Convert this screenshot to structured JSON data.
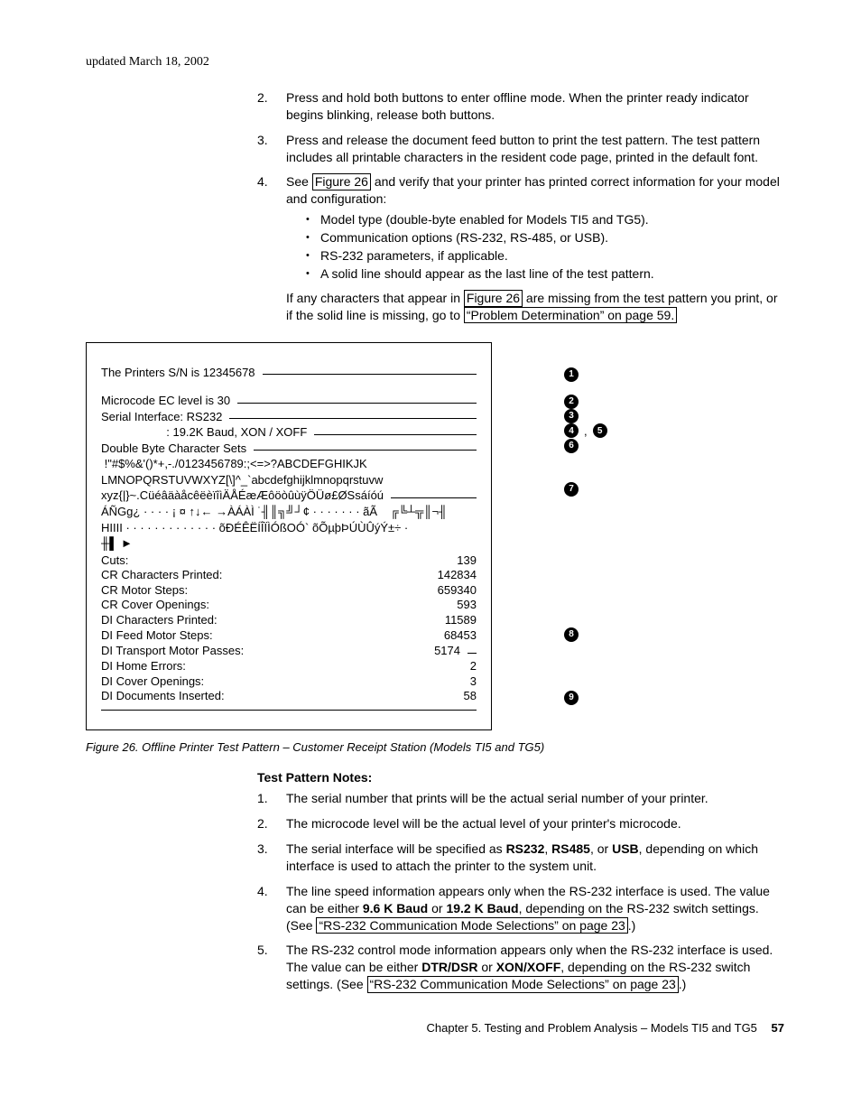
{
  "header": {
    "updated": "updated March 18, 2002"
  },
  "steps": {
    "s2": {
      "num": "2.",
      "text": "Press and hold both buttons to enter offline mode. When the printer ready indicator begins blinking, release both buttons."
    },
    "s3": {
      "num": "3.",
      "text": "Press and release the document feed button to print the test pattern. The test pattern includes all printable characters in the resident code page, printed in the default font."
    },
    "s4": {
      "num": "4.",
      "lead": "See ",
      "xref": "Figure 26",
      "tail": " and verify that your printer has printed correct information for your model and configuration:",
      "b1": "Model type (double-byte enabled for Models TI5 and TG5).",
      "b2": "Communication options (RS-232, RS-485, or USB).",
      "b3": "RS-232 parameters, if applicable.",
      "b4": "A solid line should appear as the last line of the test pattern.",
      "follow_a": "If any characters that appear in ",
      "follow_xref1": "Figure 26",
      "follow_b": " are missing from the test pattern you print, or if the solid line is missing, go to ",
      "follow_xref2": "“Problem Determination” on page 59."
    }
  },
  "figure": {
    "l1": "The Printers S/N is 12345678",
    "l2": "Microcode EC level is 30",
    "l3": "Serial Interface: RS232",
    "l4": "                    : 19.2K Baud, XON / XOFF",
    "l5": "Double Byte Character Sets",
    "l6": " !\"#$%&'()*+,-./0123456789:;<=>?ABCDEFGHIKJK",
    "l7": "LMNOPQRSTUVWXYZ[\\]^_`abcdefghijklmnopqrstuvw",
    "l8": "xyz{|}~.CüéâäàåcêëèïîìÄÅÉæÆôöòûùÿÖÜø£ØSsáíóú",
    "l9": "ÁÑGg¿ · · · · ¡ ¤ ↑↓← →ÀÁÀÌ ˙╢║╗╝┘¢ · · · · · · · ãÃ    ╔╚┴╦║¬╢",
    "l10": "HIIII · · · · · · · · · · · · · õĐÉÊËÍÎÏÌÓßOÓ` õÕµþÞÚÙÛýÝ±÷ ·",
    "l11": "╫▌ ►",
    "stats": {
      "r1l": "Cuts:",
      "r1v": "139",
      "r2l": "CR Characters Printed:",
      "r2v": "142834",
      "r3l": "CR Motor Steps:",
      "r3v": "659340",
      "r4l": "CR Cover Openings:",
      "r4v": "593",
      "r5l": "DI Characters Printed:",
      "r5v": "11589",
      "r6l": "DI Feed Motor Steps:",
      "r6v": "68453",
      "r7l": "DI Transport Motor Passes:",
      "r7v": "5174",
      "r8l": "DI Home Errors:",
      "r8v": "2",
      "r9l": "DI Cover Openings:",
      "r9v": "3",
      "r10l": "DI Documents Inserted:",
      "r10v": "58"
    },
    "caption": "Figure 26. Offline Printer Test Pattern – Customer Receipt Station (Models TI5 and TG5)",
    "callouts": {
      "c1": "1",
      "c2": "2",
      "c3": "3",
      "c45": "4",
      "c45b": "5",
      "c45sep": ",",
      "c6": "6",
      "c7": "7",
      "c8": "8",
      "c9": "9"
    }
  },
  "notes": {
    "heading": "Test Pattern Notes:",
    "n1": {
      "num": "1.",
      "text": "The serial number that prints will be the actual serial number of your printer."
    },
    "n2": {
      "num": "2.",
      "text": "The microcode level will be the actual level of your printer's microcode."
    },
    "n3": {
      "num": "3.",
      "a": "The serial interface will be specified as ",
      "b1": "RS232",
      "c": ", ",
      "b2": "RS485",
      "d": ", or ",
      "b3": "USB",
      "e": ", depending on which interface is used to attach the printer to the system unit."
    },
    "n4": {
      "num": "4.",
      "a": "The line speed information appears only when the RS-232 interface is used. The value can be either ",
      "b1": "9.6 K Baud",
      "c": " or ",
      "b2": "19.2 K Baud",
      "d": ", depending on the RS-232 switch settings. (See ",
      "xref": "“RS-232 Communication Mode Selections” on page 23",
      "e": ".)"
    },
    "n5": {
      "num": "5.",
      "a": "The RS-232 control mode information appears only when the RS-232 interface is used. The value can be either ",
      "b1": "DTR/DSR",
      "c": " or ",
      "b2": "XON/XOFF",
      "d": ", depending on the RS-232 switch settings. (See ",
      "xref": "“RS-232 Communication Mode Selections” on page 23",
      "e": ".)"
    }
  },
  "footer": {
    "text": "Chapter 5. Testing and Problem Analysis – Models TI5 and TG5",
    "page": "57"
  }
}
